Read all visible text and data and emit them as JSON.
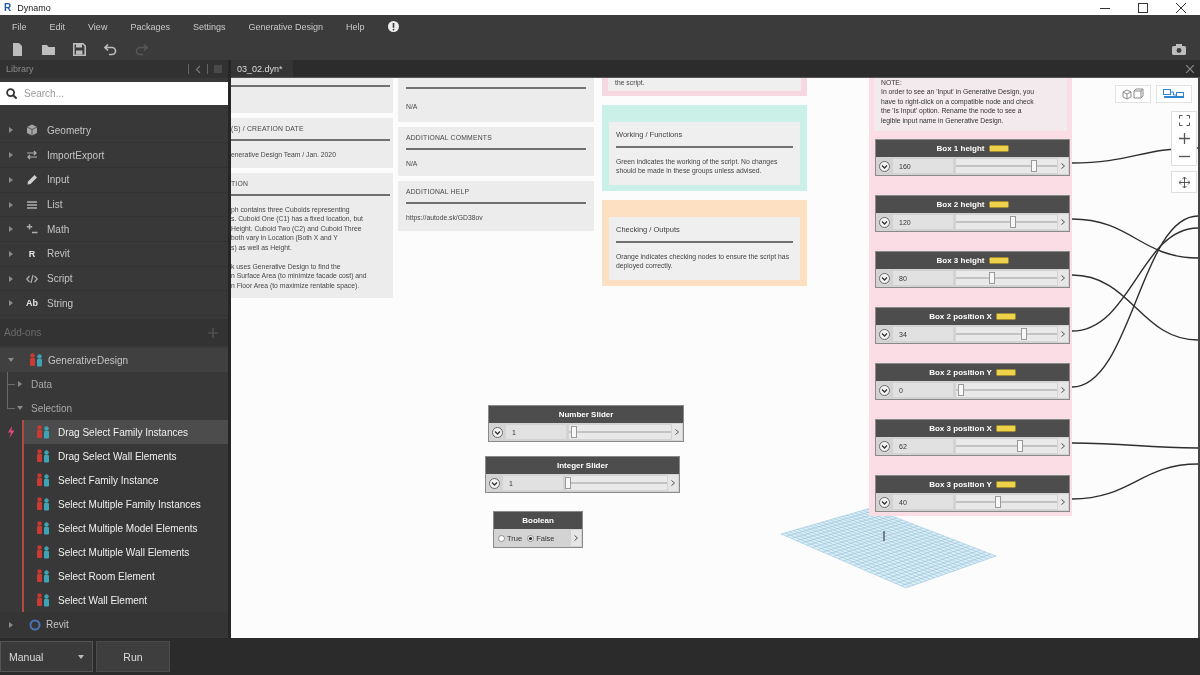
{
  "window": {
    "logo": "R",
    "title": "Dynamo"
  },
  "menu": [
    "File",
    "Edit",
    "View",
    "Packages",
    "Settings",
    "Generative Design",
    "Help"
  ],
  "toolbar": [
    {
      "kind": "new",
      "disabled": false
    },
    {
      "kind": "open",
      "disabled": false
    },
    {
      "kind": "save",
      "disabled": false
    },
    {
      "kind": "undo",
      "disabled": false
    },
    {
      "kind": "redo",
      "disabled": true
    }
  ],
  "library": {
    "title": "Library",
    "search": {
      "placeholder": "Search..."
    },
    "categories": [
      {
        "label": "Geometry",
        "kind": "geometry",
        "expanded": false
      },
      {
        "label": "ImportExport",
        "kind": "import_export",
        "expanded": false
      },
      {
        "label": "Input",
        "kind": "input",
        "expanded": false
      },
      {
        "label": "List",
        "kind": "list",
        "expanded": false
      },
      {
        "label": "Math",
        "kind": "math",
        "expanded": false
      },
      {
        "label": "Revit",
        "kind": "letter",
        "glyph": "R",
        "expanded": false
      },
      {
        "label": "Script",
        "kind": "script",
        "expanded": false
      },
      {
        "label": "String",
        "kind": "letter",
        "glyph": "Ab",
        "expanded": false
      }
    ],
    "addons": {
      "title": "Add-ons",
      "packages": [
        {
          "label": "GenerativeDesign",
          "kind": "figures",
          "expanded": true,
          "children": [
            {
              "label": "Data",
              "expanded": false
            },
            {
              "label": "Selection",
              "expanded": true,
              "children": [
                {
                  "label": "Drag Select Family Instances",
                  "selected": true
                },
                {
                  "label": "Drag Select Wall Elements",
                  "selected": false
                },
                {
                  "label": "Select Family Instance",
                  "selected": false
                },
                {
                  "label": "Select Multiple Family Instances",
                  "selected": false
                },
                {
                  "label": "Select Multiple Model Elements",
                  "selected": false
                },
                {
                  "label": "Select Multiple Wall Elements",
                  "selected": false
                },
                {
                  "label": "Select Room Element",
                  "selected": false
                },
                {
                  "label": "Select Wall Element",
                  "selected": false
                }
              ]
            }
          ]
        },
        {
          "label": "Revit",
          "kind": "ring",
          "expanded": false
        }
      ]
    }
  },
  "document_tab": {
    "label": "03_02.dyn*"
  },
  "canvas": {
    "view_toggle": [
      {
        "kind": "geometry",
        "selected": false
      },
      {
        "kind": "graph",
        "selected": true
      }
    ],
    "info_columns": [
      {
        "cards": [
          {
            "kind": "blank"
          },
          {
            "kind": "note",
            "heading": "(S) / CREATION DATE",
            "body": "enerative Design Team / Jan. 2020"
          },
          {
            "kind": "note",
            "heading": "TION",
            "body": "ph contains three Cuboids representing\ns. Cuboid One (C1) has a fixed location, but\nHeight. Cuboid Two (C2) and Cuboid Three\nboth vary in Location (Both X and Y\ns) as well as Height.\n\nk uses Generative Design to find the\nn Surface Area (to minimize facade cost) and\nn Floor Area (to maximize rentable space)."
          }
        ]
      },
      {
        "cards": [
          {
            "kind": "note",
            "body": "N/A"
          },
          {
            "kind": "note",
            "heading": "ADDITIONAL COMMENTS",
            "body": "N/A"
          },
          {
            "kind": "note",
            "heading": "ADDITIONAL HELP",
            "body": "https://autode.sk/GD38ov"
          }
        ]
      }
    ],
    "color_legend": [
      {
        "color": "#f8d8e0",
        "body": "the script."
      },
      {
        "color": "#cbf0e7",
        "heading": "Working / Functions",
        "body": "Green indicates the working of the script. No changes should be made in these groups unless advised."
      },
      {
        "color": "#fde0c2",
        "heading": "Checking / Outputs",
        "body": "Orange indicates checking nodes to ensure the script has deployed correctly."
      }
    ],
    "input_group": {
      "note": "NOTE:\nIn order to see an 'Input' in Generative Design, you\nhave to right-click on a compatible node and check\nthe 'Is Input' option. Rename the node to see a\nlegible input name in Generative Design.",
      "sliders": [
        {
          "title": "Box 1 height",
          "is_input": true,
          "value": "160",
          "level": 0.77
        },
        {
          "title": "Box 2 height",
          "is_input": true,
          "value": "120",
          "level": 0.56
        },
        {
          "title": "Box 3 height",
          "is_input": true,
          "value": "80",
          "level": 0.36
        },
        {
          "title": "Box 2 position X",
          "is_input": true,
          "value": "34",
          "level": 0.67
        },
        {
          "title": "Box 2 position Y",
          "is_input": true,
          "value": "0",
          "level": 0.05
        },
        {
          "title": "Box 3 position X",
          "is_input": true,
          "value": "62",
          "level": 0.63
        },
        {
          "title": "Box 3 position Y",
          "is_input": true,
          "value": "40",
          "level": 0.42
        }
      ]
    },
    "nodes": [
      {
        "kind": "slider",
        "title": "Number Slider",
        "is_input": false,
        "value": "1",
        "level": 0.05
      },
      {
        "kind": "slider",
        "title": "Integer Slider",
        "is_input": false,
        "value": "1",
        "level": 0.02
      },
      {
        "kind": "boolean",
        "title": "Boolean",
        "options": [
          {
            "label": "True",
            "selected": false
          },
          {
            "label": "False",
            "selected": true
          }
        ]
      }
    ]
  },
  "run_bar": {
    "mode": "Manual",
    "run_button": "Run"
  }
}
